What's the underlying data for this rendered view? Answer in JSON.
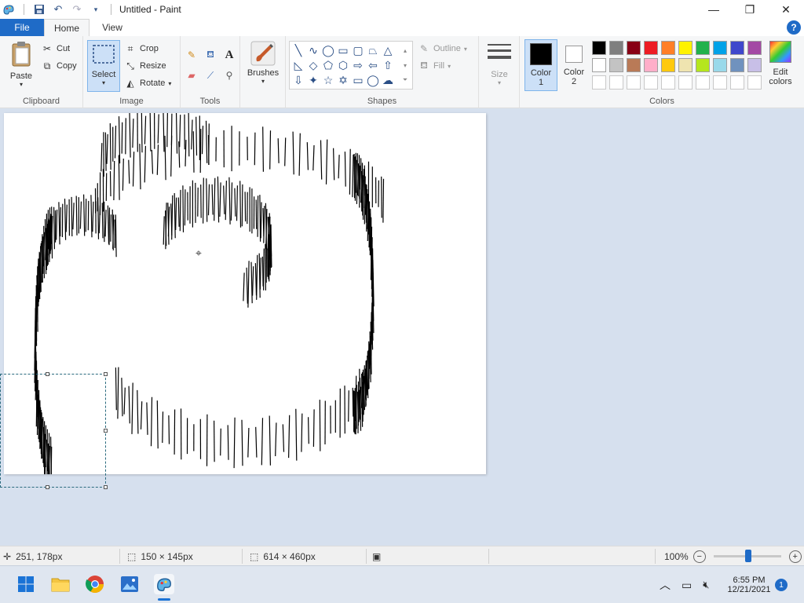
{
  "titlebar": {
    "title": "Untitled - Paint"
  },
  "tabs": {
    "file": "File",
    "home": "Home",
    "view": "View"
  },
  "help_label": "?",
  "clipboard": {
    "paste": "Paste",
    "cut": "Cut",
    "copy": "Copy",
    "label": "Clipboard"
  },
  "image": {
    "select": "Select",
    "crop": "Crop",
    "resize": "Resize",
    "rotate": "Rotate",
    "label": "Image"
  },
  "tools": {
    "label": "Tools"
  },
  "brushes": {
    "label": "Brushes"
  },
  "shapes": {
    "outline": "Outline",
    "fill": "Fill",
    "label": "Shapes"
  },
  "size": {
    "label": "Size"
  },
  "colors": {
    "color1": "Color",
    "color1_num": "1",
    "color2": "Color",
    "color2_num": "2",
    "edit1": "Edit",
    "edit2": "colors",
    "label": "Colors",
    "color1_value": "#000000",
    "color2_value": "#ffffff",
    "palette_row1": [
      "#000000",
      "#7f7f7f",
      "#880015",
      "#ed1c24",
      "#ff7f27",
      "#fff200",
      "#22b14c",
      "#00a2e8",
      "#3f48cc",
      "#a349a4"
    ],
    "palette_row2": [
      "#ffffff",
      "#c3c3c3",
      "#b97a57",
      "#ffaec9",
      "#ffc90e",
      "#efe4b0",
      "#b5e61d",
      "#99d9ea",
      "#7092be",
      "#c8bfe7"
    ]
  },
  "status": {
    "cursor_pos": "251, 178px",
    "selection_size": "150 × 145px",
    "canvas_size": "614 × 460px",
    "zoom": "100%"
  },
  "tray": {
    "time": "6:55 PM",
    "date": "12/21/2021",
    "badge": "1"
  }
}
